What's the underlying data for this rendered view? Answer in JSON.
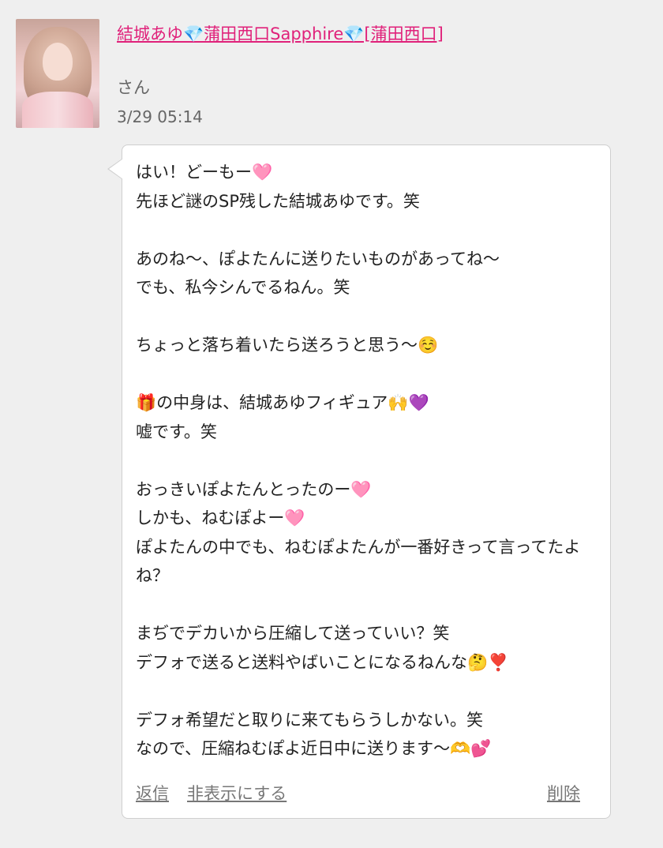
{
  "post": {
    "author_name": "結城あゆ💎蒲田西口Sapphire💎[蒲田西口]",
    "honorific": "さん",
    "timestamp": "3/29 05:14",
    "message": "はい！どーもー🩷\n先ほど謎のSP残した結城あゆです。笑\n\nあのね〜、ぽよたんに送りたいものがあってね〜\nでも、私今シんでるねん。笑\n\nちょっと落ち着いたら送ろうと思う〜☺️\n\n🎁の中身は、結城あゆフィギュア🙌💜\n嘘です。笑\n\nおっきいぽよたんとったのー🩷\nしかも、ねむぽよー🩷\nぽよたんの中でも、ねむぽよたんが一番好きって言ってたよね？\n\nまぢでデカいから圧縮して送っていい？笑\nデフォで送ると送料やばいことになるねんな🤔❣️\n\nデフォ希望だと取りに来てもらうしかない。笑\nなので、圧縮ねむぽよ近日中に送ります〜🫶💕"
  },
  "actions": {
    "reply": "返信",
    "hide": "非表示にする",
    "delete": "削除"
  },
  "colors": {
    "link": "#e0217a",
    "background": "#efefef",
    "bubble": "#ffffff"
  }
}
